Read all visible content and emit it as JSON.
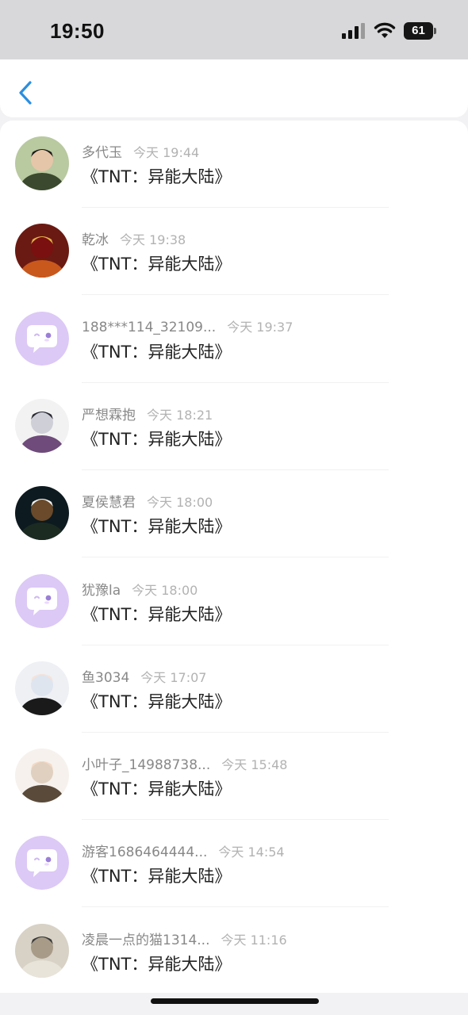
{
  "status_bar": {
    "time": "19:50",
    "battery": "61"
  },
  "nav": {
    "back_icon": "chevron-left-icon",
    "accent": "#2a8fe0"
  },
  "items": [
    {
      "name": "多代玉",
      "time": "今天 19:44",
      "message": "《TNT：异能大陆》",
      "avatar": "photo"
    },
    {
      "name": "乾冰",
      "time": "今天 19:38",
      "message": "《TNT：异能大陆》",
      "avatar": "photo"
    },
    {
      "name": "188***114_32109...",
      "time": "今天 19:37",
      "message": "《TNT：异能大陆》",
      "avatar": "default"
    },
    {
      "name": "严想霖抱",
      "time": "今天 18:21",
      "message": "《TNT：异能大陆》",
      "avatar": "photo"
    },
    {
      "name": "夏侯慧君",
      "time": "今天 18:00",
      "message": "《TNT：异能大陆》",
      "avatar": "photo"
    },
    {
      "name": "犹豫la",
      "time": "今天 18:00",
      "message": "《TNT：异能大陆》",
      "avatar": "default"
    },
    {
      "name": "鱼3034",
      "time": "今天 17:07",
      "message": "《TNT：异能大陆》",
      "avatar": "photo"
    },
    {
      "name": "小叶子_14988738...",
      "time": "今天 15:48",
      "message": "《TNT：异能大陆》",
      "avatar": "photo"
    },
    {
      "name": "游客1686464444...",
      "time": "今天 14:54",
      "message": "《TNT：异能大陆》",
      "avatar": "default"
    },
    {
      "name": "凌晨一点的猫1314...",
      "time": "今天 11:16",
      "message": "《TNT：异能大陆》",
      "avatar": "photo"
    }
  ]
}
